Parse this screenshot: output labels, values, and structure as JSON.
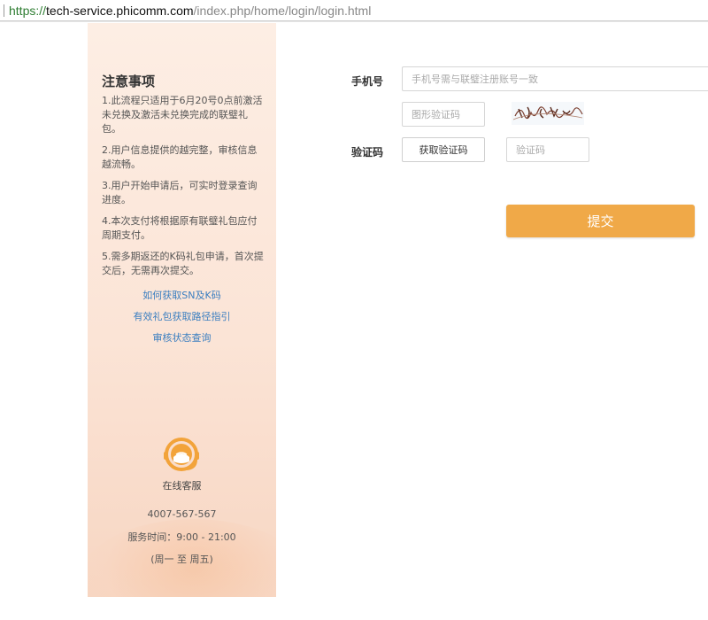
{
  "browser": {
    "url_scheme": "https://",
    "url_host": "tech-service.phicomm.com",
    "url_path": "/index.php/home/login/login.html"
  },
  "sidebar": {
    "title": "注意事项",
    "notes": [
      "1.此流程只适用于6月20号0点前激活未兑换及激活未兑换完成的联璧礼包。",
      "2.用户信息提供的越完整，审核信息越流畅。",
      "3.用户开始申请后，可实时登录查询进度。",
      "4.本次支付将根据原有联璧礼包应付周期支付。",
      "5.需多期返还的K码礼包申请，首次提交后，无需再次提交。"
    ],
    "links": [
      "如何获取SN及K码",
      "有效礼包获取路径指引",
      "审核状态查询"
    ],
    "service": {
      "icon": "customer-service-headset-icon",
      "label": "在线客服",
      "phone": "4007-567-567",
      "hours": "服务时间：9:00 - 21:00",
      "days": "(周一 至 周五)"
    }
  },
  "form": {
    "phone_label": "手机号",
    "phone_placeholder": "手机号需与联璧注册账号一致",
    "captcha_placeholder": "图形验证码",
    "captcha_icon": "captcha-image",
    "sms_label": "验证码",
    "sms_button": "获取验证码",
    "sms_placeholder": "验证码",
    "submit": "提交"
  },
  "colors": {
    "accent": "#f0a948",
    "link": "#3a7ec0",
    "sidebar_bg": "#fbe4d6"
  }
}
